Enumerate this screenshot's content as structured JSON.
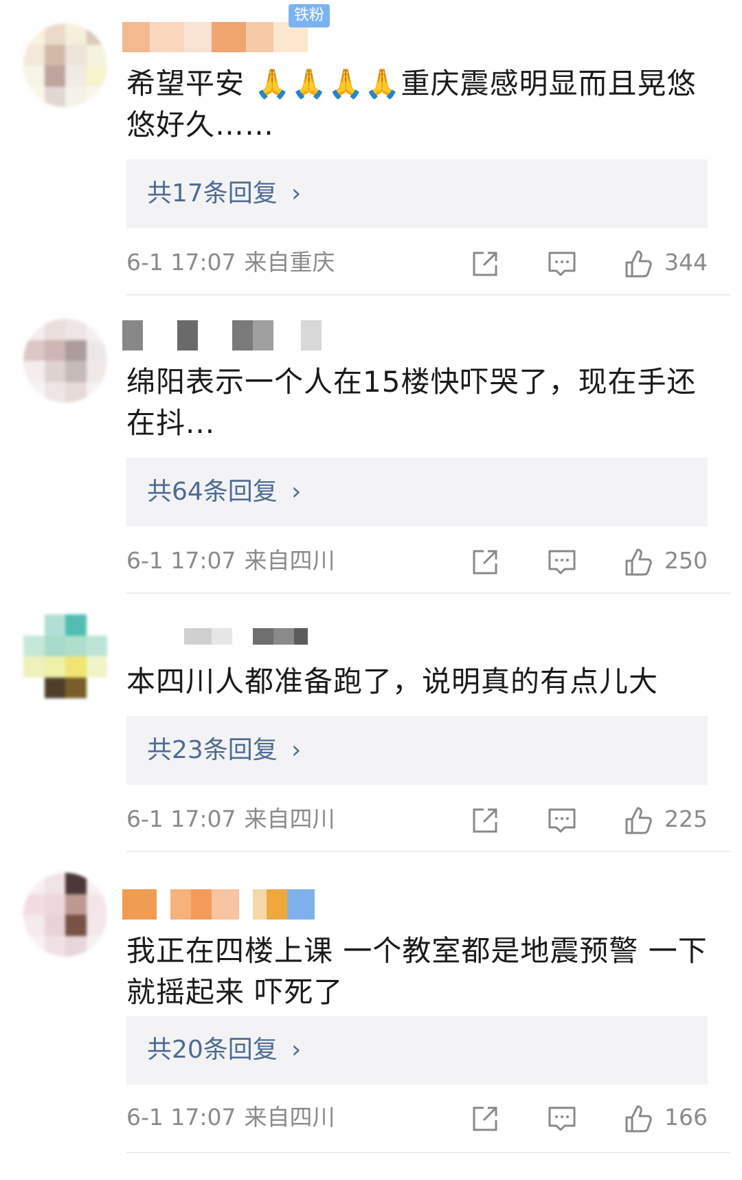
{
  "comments": [
    {
      "badge": "铁粉",
      "text": "希望平安 🙏🙏🙏🙏重庆震感明显而且晃悠悠好久……",
      "replies_label": "共17条回复",
      "replies_arrow": "›",
      "time": "6-1 17:07",
      "location": "来自重庆",
      "likes": "344"
    },
    {
      "text": "绵阳表示一个人在15楼快吓哭了，现在手还在抖...",
      "replies_label": "共64条回复",
      "replies_arrow": "›",
      "time": "6-1 17:07",
      "location": "来自四川",
      "likes": "250"
    },
    {
      "text": "本四川人都准备跑了，说明真的有点儿大",
      "replies_label": "共23条回复",
      "replies_arrow": "›",
      "time": "6-1 17:07",
      "location": "来自四川",
      "likes": "225"
    },
    {
      "text": "我正在四楼上课 一个教室都是地震预警 一下就摇起来 吓死了",
      "replies_label": "共20条回复",
      "replies_arrow": "›",
      "time": "6-1 17:07",
      "location": "来自四川",
      "likes": "166"
    }
  ],
  "icons": {
    "share": "share-icon",
    "comment": "comment-icon",
    "like": "like-icon"
  },
  "colors": {
    "reply_link": "#4f6b91",
    "reply_bg": "#f3f3f5",
    "meta_text": "#8a8a8a",
    "badge_bg": "#7ab4f0"
  }
}
